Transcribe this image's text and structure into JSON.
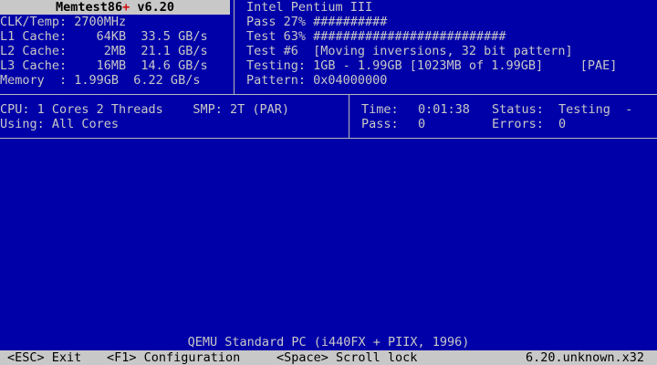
{
  "title": {
    "name": "Memtest86",
    "plus": "+",
    "version": " v6.20"
  },
  "system": {
    "clk": "CLK/Temp: 2700MHz",
    "l1": "L1 Cache:    64KB  33.5 GB/s",
    "l2": "L2 Cache:     2MB  21.1 GB/s",
    "l3": "L3 Cache:    16MB  14.6 GB/s",
    "memory": "Memory  : 1.99GB  6.22 GB/s"
  },
  "test": {
    "cpu_name": "Intel Pentium III",
    "pass_line": "Pass 27% ##########",
    "test_line": "Test 63% ##########################",
    "test_num": "Test #6  [Moving inversions, 32 bit pattern]",
    "testing": "Testing: 1GB - 1.99GB [1023MB of 1.99GB]     [PAE]",
    "pattern": "Pattern: 0x04000000"
  },
  "cpu_info": {
    "cpu_line": "CPU: 1 Cores 2 Threads    SMP: 2T (PAR)",
    "using": "Using: All Cores"
  },
  "stats": {
    "time_label": "Time:",
    "time_value": "0:01:38",
    "status_label": "Status:",
    "status_value": "Testing  -",
    "pass_label": "Pass:",
    "pass_value": "0",
    "errors_label": "Errors:",
    "errors_value": "0"
  },
  "machine": "QEMU Standard PC (i440FX + PIIX, 1996)",
  "footer": {
    "esc": "<ESC> Exit",
    "f1": "<F1> Configuration",
    "space": "<Space> Scroll lock",
    "version": "6.20.unknown.x32"
  },
  "colors": {
    "background": "#0000a8",
    "text": "#c8c8c8",
    "bar": "#c8c8c8",
    "accent": "#d01010"
  }
}
